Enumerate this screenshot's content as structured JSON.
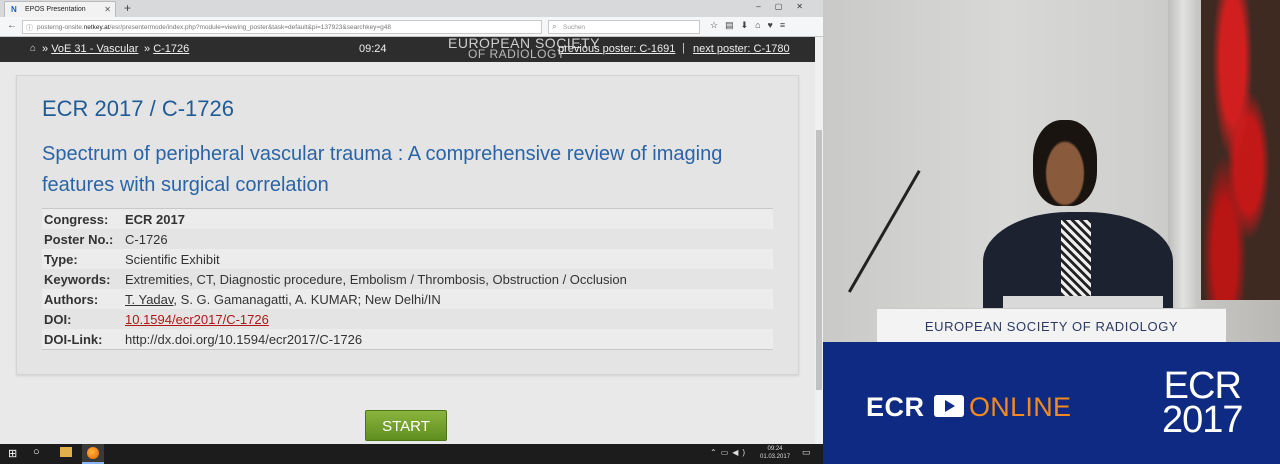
{
  "browser": {
    "tab_title": "EPOS Presentation",
    "new_tab": "+",
    "url_prefix": "posterng-onsite.",
    "url_domain": "netkey.at",
    "url_rest": "/esr/presentermode/index.php?module=viewing_poster&task=default&pi=137923&searchkey=g48",
    "search_placeholder": "Suchen"
  },
  "poster_bar": {
    "crumb1": "VoE 31 - Vascular",
    "crumb2": "C-1726",
    "timer": "09:24",
    "logo_line1": "EUROPEAN SOCIETY",
    "logo_line2": "OF RADIOLOGY",
    "previous_poster": "previous poster: C-1691",
    "separator": "|",
    "next_poster": "next poster: C-1780"
  },
  "poster": {
    "title": "ECR 2017 / C-1726",
    "subtitle": "Spectrum of peripheral vascular trauma : A comprehensive review of imaging features with surgical correlation",
    "rows": [
      {
        "key": "Congress:",
        "value": "ECR 2017"
      },
      {
        "key": "Poster No.:",
        "value": "C-1726"
      },
      {
        "key": "Type:",
        "value": "Scientific Exhibit"
      },
      {
        "key": "Keywords:",
        "value": "Extremities, CT, Diagnostic procedure, Embolism / Thrombosis, Obstruction / Occlusion"
      },
      {
        "key": "Authors:",
        "value_underlined": "T. Yadav",
        "value_rest": ", S. G. Gamanagatti, A. KUMAR; New Delhi/IN"
      },
      {
        "key": "DOI:",
        "value": "10.1594/ecr2017/C-1726"
      },
      {
        "key": "DOI-Link:",
        "value": "http://dx.doi.org/10.1594/ecr2017/C-1726"
      }
    ],
    "start_button": "START"
  },
  "taskbar": {
    "clock_time": "09:24",
    "clock_date": "01.03.2017"
  },
  "video": {
    "podium_text": "EUROPEAN SOCIETY OF RADIOLOGY",
    "banner_ecr": "ECR",
    "banner_online": "ONLINE",
    "banner_ecr_big": "ECR",
    "banner_year": "2017",
    "brand_blue": "#0f2a82",
    "brand_orange": "#f48a1f"
  }
}
